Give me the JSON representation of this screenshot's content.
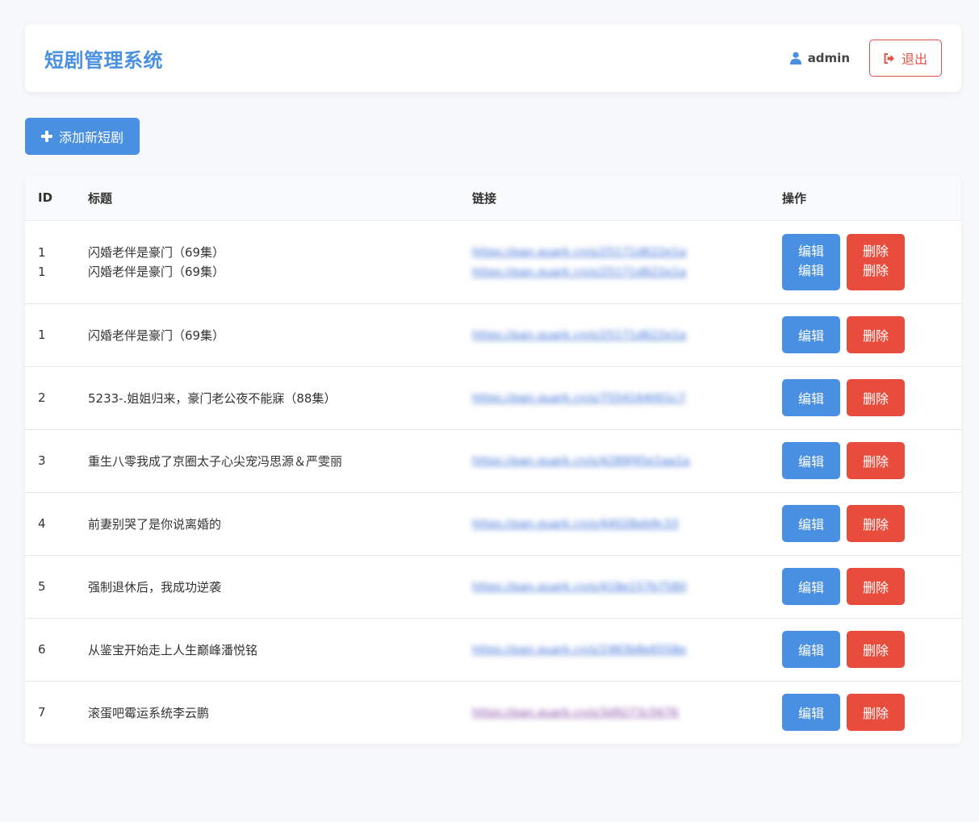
{
  "header": {
    "title": "短剧管理系统",
    "user": "admin",
    "logout_label": "退出"
  },
  "add_button_label": "添加新短剧",
  "table": {
    "columns": [
      "ID",
      "标题",
      "链接",
      "操作"
    ],
    "edit_label": "编辑",
    "delete_label": "删除",
    "rows": [
      {
        "id": "1",
        "title": "闪婚老伴是豪门（69集）",
        "link": "https://pan.quark.cn/s/25171d622e1a",
        "id2": "1",
        "title2": "闪婚老伴是豪门（69集）",
        "link2": "https://pan.quark.cn/s/25171d622e1a"
      },
      {
        "id": "1",
        "title": "闪婚老伴是豪门（69集）",
        "link": "https://pan.quark.cn/s/25171d622e1a"
      },
      {
        "id": "2",
        "title": "5233-.姐姐归来，豪门老公夜不能寐（88集）",
        "link": "https://pan.quark.cn/s/7554164001c7"
      },
      {
        "id": "3",
        "title": "重生八零我成了京圈太子心尖宠冯思源＆严雯丽",
        "link": "https://pan.quark.cn/s/4289f45e1aa1a"
      },
      {
        "id": "4",
        "title": "前妻别哭了是你说离婚的",
        "link": "https://pan.quark.cn/s/44028eb9c33"
      },
      {
        "id": "5",
        "title": "强制退休后，我成功逆袭",
        "link": "https://pan.quark.cn/s/418e157b7580"
      },
      {
        "id": "6",
        "title": "从鉴宝开始走上人生巅峰潘悦铭",
        "link": "https://pan.quark.cn/s/1983b8e6558e"
      },
      {
        "id": "7",
        "title": "滚蛋吧霉运系统李云鹏",
        "link": "https://pan.quark.cn/s/3d9273c5676"
      }
    ]
  },
  "colors": {
    "primary": "#4a90e2",
    "danger": "#e74c3c",
    "background": "#f7f8fa"
  },
  "icons": {
    "user": "user-icon",
    "logout": "sign-out-icon",
    "add": "plus-icon"
  }
}
